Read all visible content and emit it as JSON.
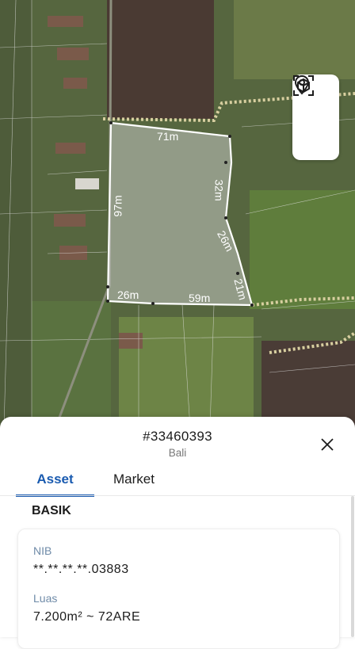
{
  "map": {
    "edge_labels": [
      "71m",
      "32m",
      "26m",
      "21m",
      "59m",
      "26m",
      "97m"
    ],
    "controls": {
      "location_icon": "location-pin-icon",
      "cube_icon": "3d-cube-icon"
    }
  },
  "sheet": {
    "title": "#33460393",
    "subtitle": "Bali",
    "close_icon": "close-icon",
    "tabs": [
      {
        "label": "Asset"
      },
      {
        "label": "Market"
      }
    ],
    "active_tab": "Asset",
    "section_title": "BASIK",
    "fields": [
      {
        "label": "NIB",
        "value": "**.**.**.**.03883"
      },
      {
        "label": "Luas",
        "value": "7.200m² ~ 72ARE"
      }
    ]
  },
  "colors": {
    "accent": "#1a5bb0",
    "label": "#6f8ba8",
    "boundary": "#ffffff",
    "path": "#d8cfa0"
  }
}
